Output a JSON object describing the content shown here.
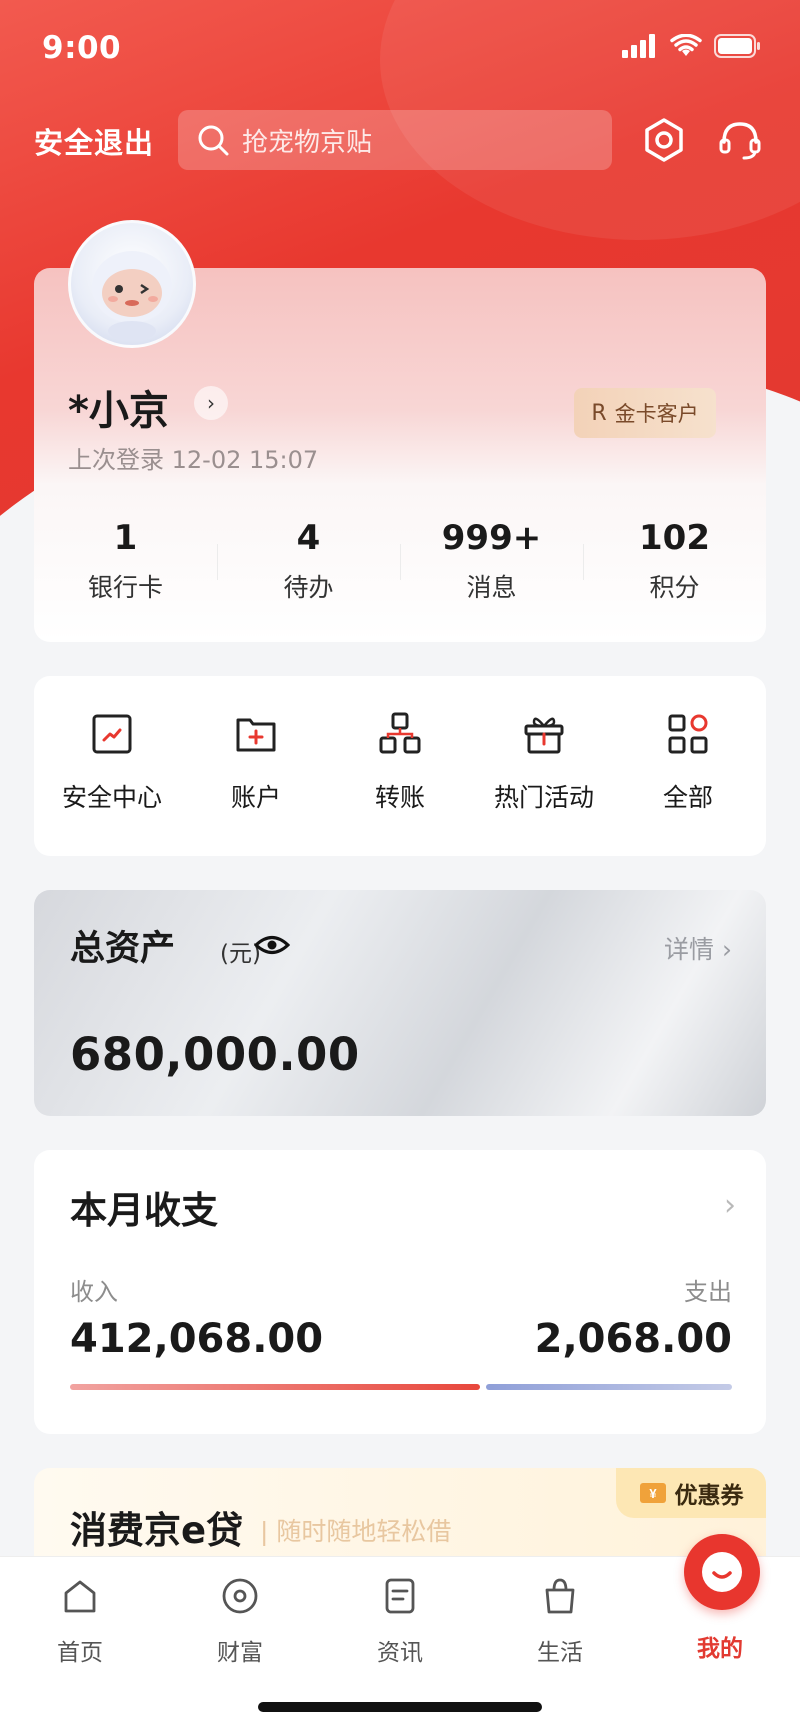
{
  "status_bar": {
    "time": "9:00"
  },
  "top_nav": {
    "logout_label": "安全退出",
    "search_placeholder": "抢宠物京贴"
  },
  "profile": {
    "username": "*小京",
    "last_login": "上次登录 12-02 15:07",
    "badge_label": "金卡客户",
    "stats": [
      {
        "value": "1",
        "label": "银行卡"
      },
      {
        "value": "4",
        "label": "待办"
      },
      {
        "value": "999+",
        "label": "消息"
      },
      {
        "value": "102",
        "label": "积分"
      }
    ]
  },
  "quick_menu": [
    {
      "label": "安全中心",
      "icon": "security-icon"
    },
    {
      "label": "账户",
      "icon": "account-icon"
    },
    {
      "label": "转账",
      "icon": "transfer-icon"
    },
    {
      "label": "热门活动",
      "icon": "gift-icon"
    },
    {
      "label": "全部",
      "icon": "all-apps-icon"
    }
  ],
  "assets": {
    "title": "总资产",
    "unit": "(元)",
    "detail_label": "详情",
    "value": "680,000.00"
  },
  "monthly": {
    "title": "本月收支",
    "income_label": "收入",
    "income_value": "412,068.00",
    "expense_label": "支出",
    "expense_value": "2,068.00",
    "income_ratio": 0.62
  },
  "loan": {
    "title": "消费京e贷",
    "subtitle": "| 随时随地轻松借",
    "coupon_label": "优惠券"
  },
  "tabs": [
    {
      "label": "首页",
      "icon": "home-icon"
    },
    {
      "label": "财富",
      "icon": "wealth-icon"
    },
    {
      "label": "资讯",
      "icon": "news-icon"
    },
    {
      "label": "生活",
      "icon": "shopping-bag-icon"
    },
    {
      "label": "我的",
      "icon": "mine-icon",
      "active": true
    }
  ],
  "colors": {
    "brand_red": "#e8382f",
    "gold": "#f3d2b8"
  }
}
